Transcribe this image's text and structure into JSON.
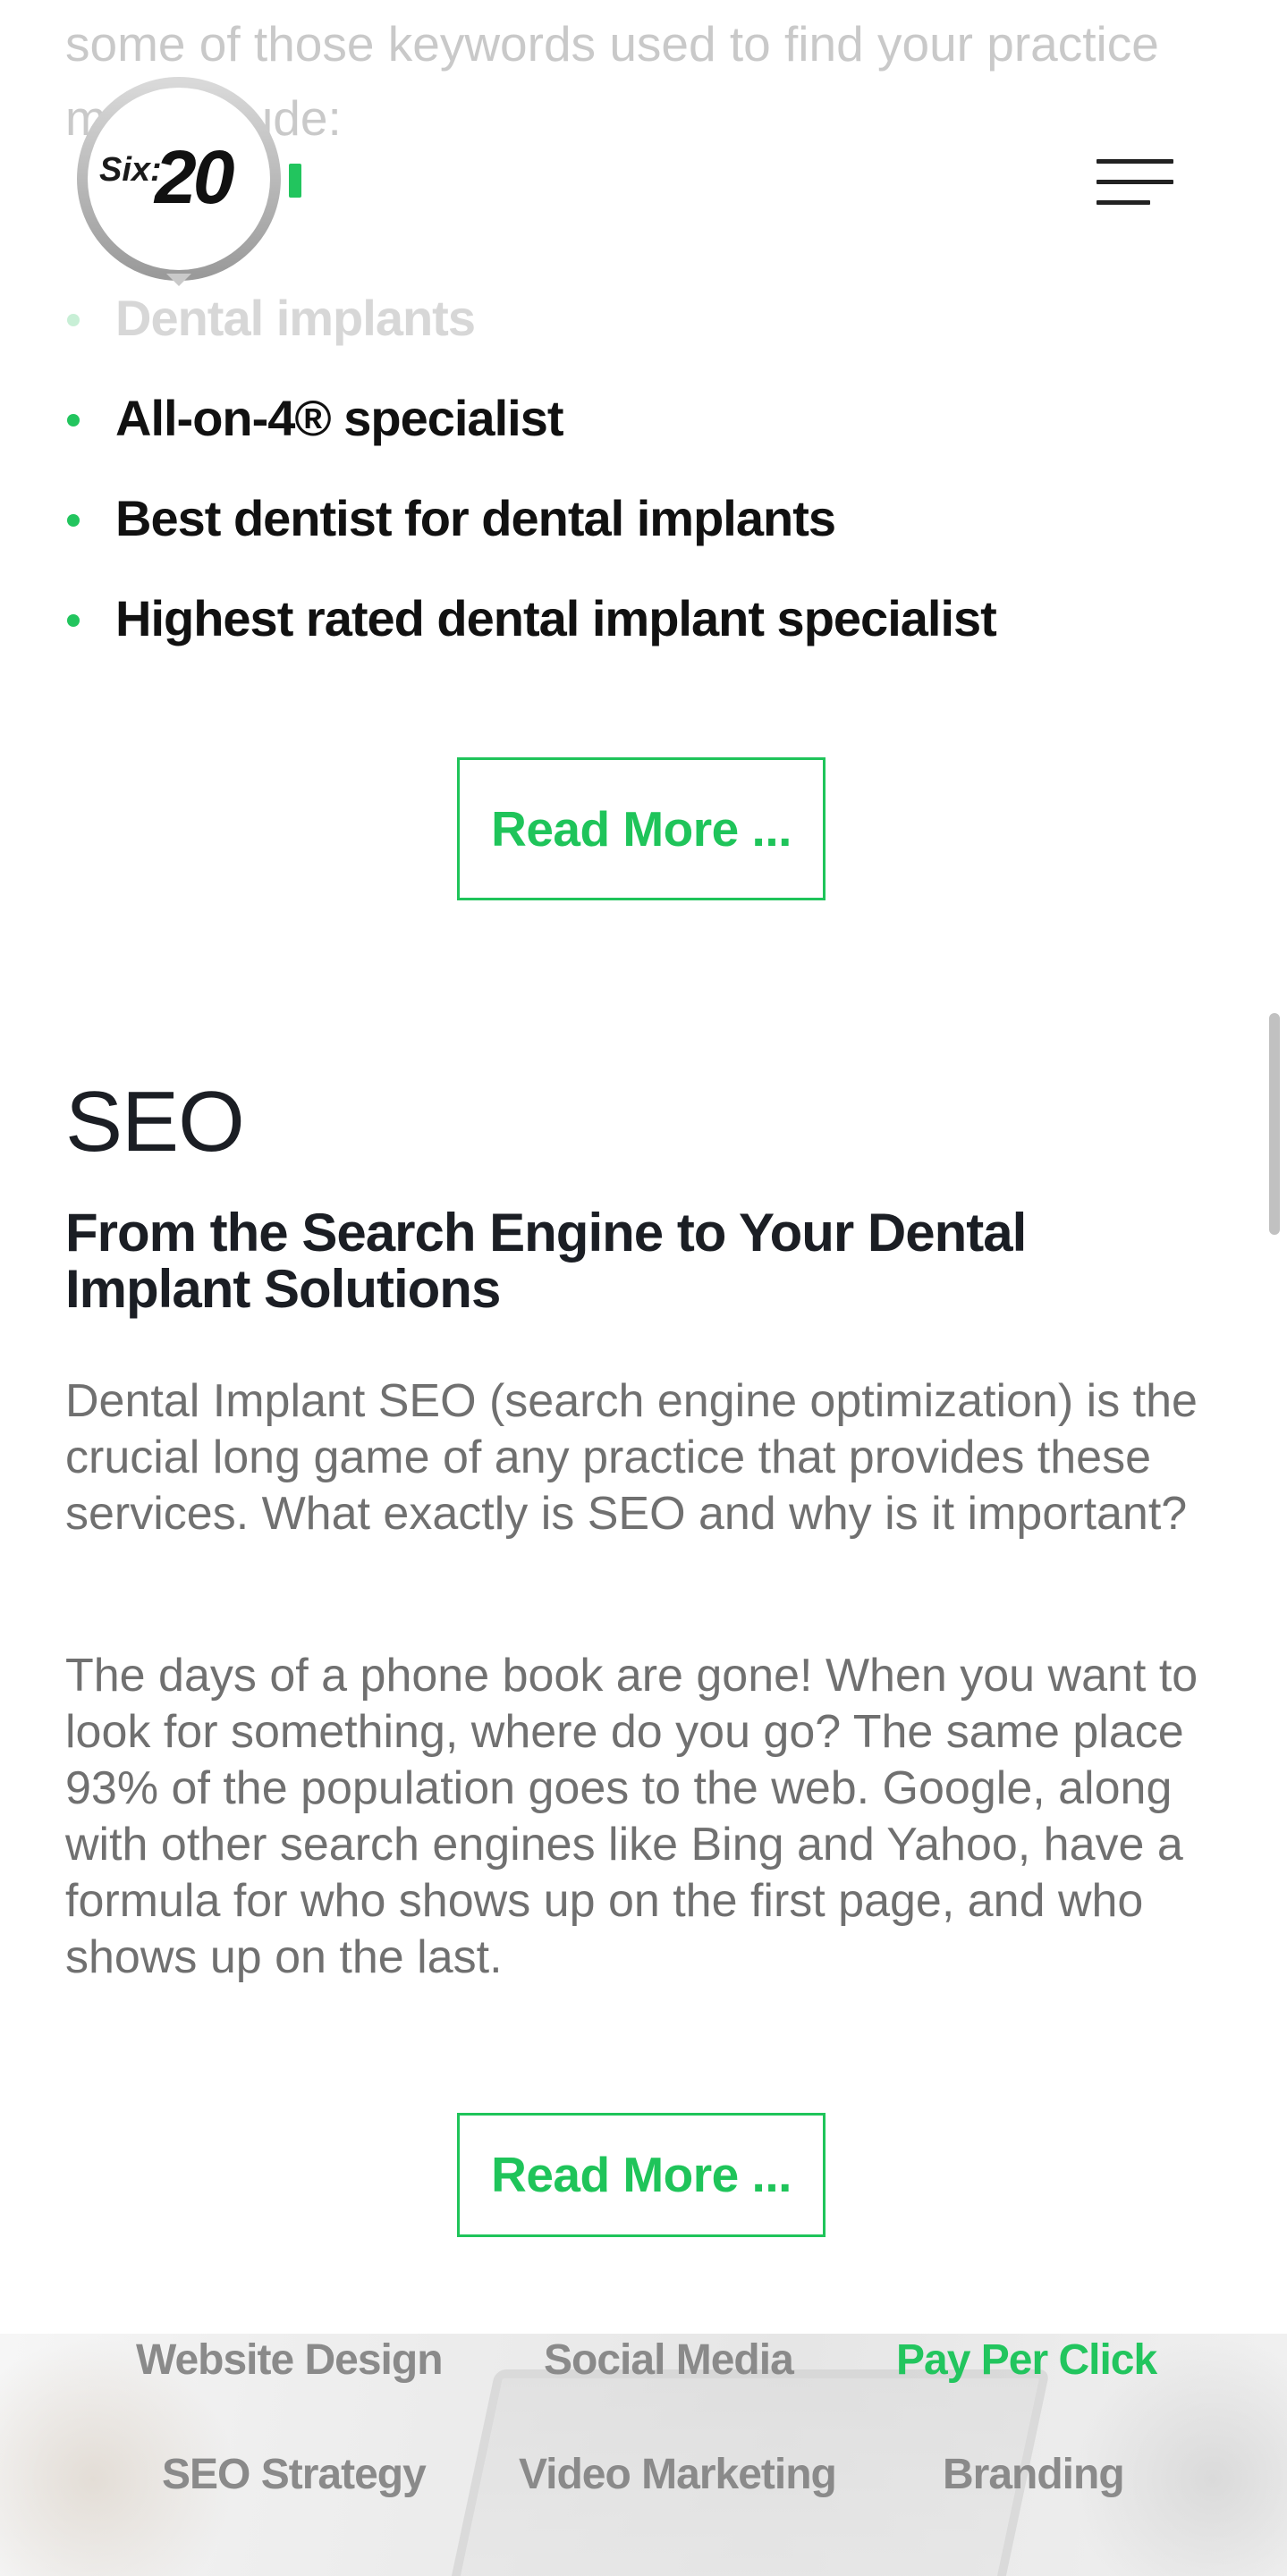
{
  "intro": {
    "text": "some of those keywords used to find your practice may include:"
  },
  "header": {
    "logo_text_small": "Six:",
    "logo_text_large": "20",
    "logo_accent_color": "#22c55e",
    "menu_icon": "hamburger-menu-icon"
  },
  "keywords": {
    "items": [
      "Dental implants",
      "All-on-4® specialist",
      "Best dentist for dental implants",
      "Highest rated dental implant specialist"
    ]
  },
  "buttons": {
    "read_more_1": "Read More ...",
    "read_more_2": "Read More ..."
  },
  "seo": {
    "title": "SEO",
    "subtitle": "From the Search Engine to Your Dental Implant Solutions",
    "paragraph_1": "Dental Implant SEO (search engine optimization) is the crucial long game of any practice that provides these services. What exactly is SEO and why is it important?",
    "paragraph_2": "The days of a phone book are gone! When you want to look for something, where do you go? The same place 93% of the population goes to the web. Google, along with other search engines like Bing and Yahoo, have a formula for who shows up on the first page, and who shows up on the last."
  },
  "services": {
    "items": [
      {
        "label": "Website Design",
        "active": false
      },
      {
        "label": "Social Media",
        "active": false
      },
      {
        "label": "Pay Per Click",
        "active": true
      },
      {
        "label": "SEO Strategy",
        "active": false
      },
      {
        "label": "Video Marketing",
        "active": false
      },
      {
        "label": "Branding",
        "active": false
      }
    ]
  },
  "colors": {
    "accent": "#22c55e",
    "heading": "#1b1e24",
    "body_text": "#707070"
  }
}
